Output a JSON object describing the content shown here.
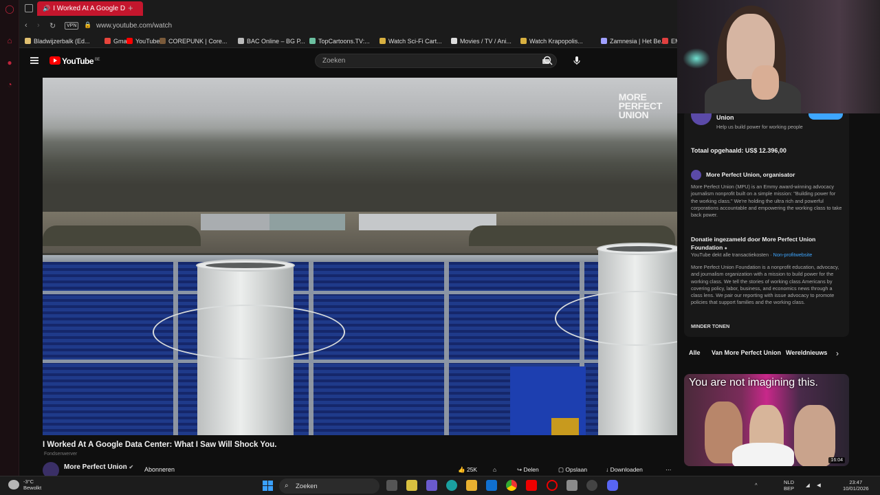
{
  "browser": {
    "tab_title": "I Worked At A Google D",
    "url": "www.youtube.com/watch",
    "vpn_label": "VPN",
    "bookmarks": [
      {
        "label": "Bladwijzerbalk (Ed...",
        "color": "#e0c070"
      },
      {
        "label": "Gmail",
        "color": "#e8453c"
      },
      {
        "label": "YouTube",
        "color": "#ff0000"
      },
      {
        "label": "COREPUNK | Core...",
        "color": "#7a5a3a"
      },
      {
        "label": "BAC Online – BG P...",
        "color": "#bbbbbb"
      },
      {
        "label": "TopCartoons.TV:...",
        "color": "#6bc0a0"
      },
      {
        "label": "Watch Sci-Fi Cart...",
        "color": "#d8b040"
      },
      {
        "label": "Movies / TV / Ani...",
        "color": "#dddddd"
      },
      {
        "label": "Watch Krapopolis...",
        "color": "#d8b040"
      },
      {
        "label": "Zamnesia | Het Be...",
        "color": "#a0a0ff"
      },
      {
        "label": "EM",
        "color": "#e04040"
      }
    ]
  },
  "youtube": {
    "logo_text": "YouTube",
    "region": "BE",
    "search_placeholder": "Zoeken"
  },
  "video": {
    "watermark_line1": "MORE",
    "watermark_line2": "PERFECT",
    "watermark_line3": "UNION",
    "title": "I Worked At A Google Data Center: What I Saw Will Shock You.",
    "fundraiser_label": "Fondsenwerver",
    "channel": "More Perfect Union",
    "subscribe_label": "Abonneren",
    "likes": "25K",
    "share_label": "Delen",
    "save_label": "Opslaan",
    "download_label": "Downloaden"
  },
  "fundraiser_panel": {
    "org_name": "Union",
    "org_tagline": "Help us build power for working people",
    "total_raised": "Totaal opgehaald: US$ 12.396,00",
    "organizer_name": "More Perfect Union, organisator",
    "organizer_desc": "More Perfect Union (MPU) is an Emmy award-winning advocacy journalism nonprofit built on a simple mission: \"Building power for the working class.\" We're holding the ultra rich and powerful corporations accountable and empowering the working class to take back power.",
    "donation_heading": "Donatie ingezameld door More Perfect Union Foundation",
    "fees_note": "YouTube dekt alle transactiekosten",
    "nonprofit_link": "Non-profitwebsite",
    "foundation_desc": "More Perfect Union Foundation is a nonprofit education, advocacy, and journalism organization with a mission to build power for the working class. We tell the stories of working class Americans by covering policy, labor, business, and economics news through a class lens. We pair our reporting with issue advocacy to promote policies that support families and the working class.",
    "show_less": "MINDER TONEN"
  },
  "chips": [
    "Alle",
    "Van More Perfect Union",
    "Wereldnieuws"
  ],
  "recommendation": {
    "thumb_caption": "You are not imagining this.",
    "duration": "16:04"
  },
  "taskbar": {
    "temperature": "-3°C",
    "weather": "Bewolkt",
    "search_label": "Zoeken",
    "lang1": "NLD",
    "lang2": "BEP",
    "time": "23:47",
    "date": "10/01/2026"
  }
}
